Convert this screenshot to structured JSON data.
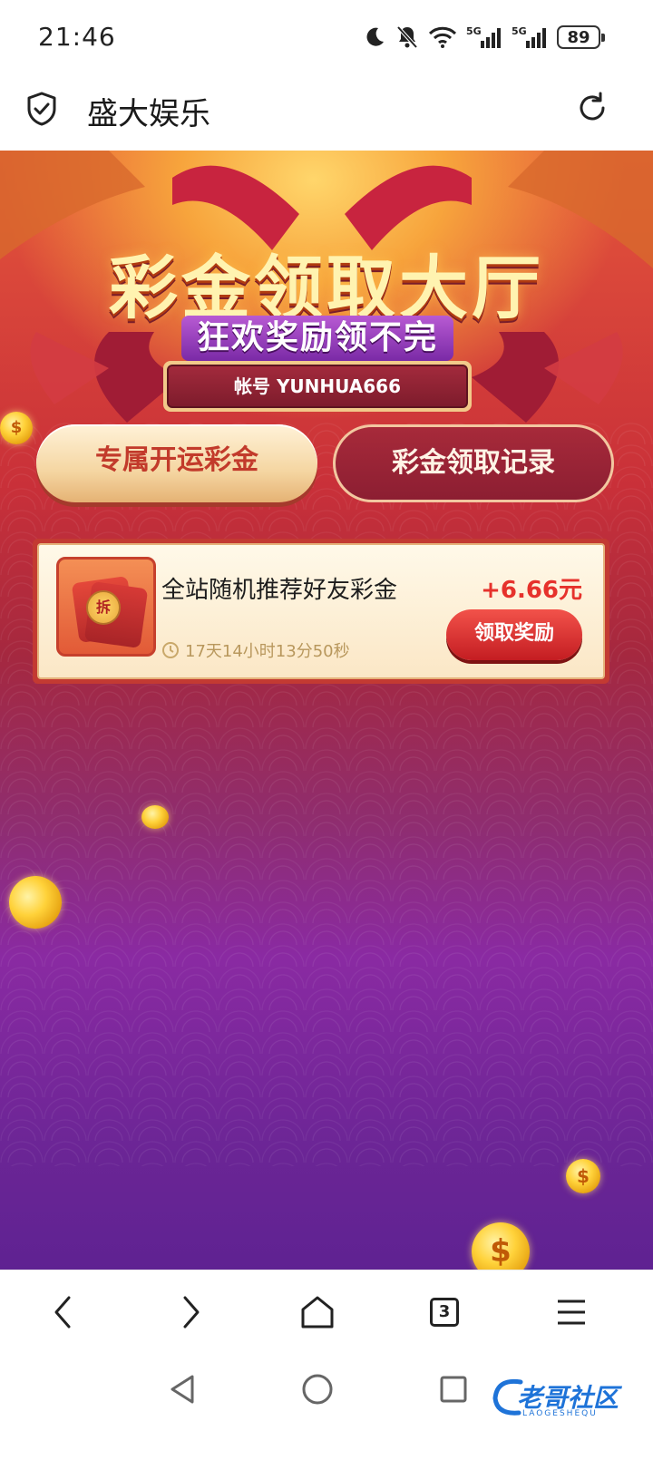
{
  "status_bar": {
    "time": "21:46",
    "battery": "89",
    "icons": [
      "moon-icon",
      "bell-muted-icon",
      "wifi-icon",
      "signal-5g-icon",
      "signal-5g-icon",
      "battery-icon"
    ],
    "network_label_1": "5G",
    "network_label_2": "5G"
  },
  "browser": {
    "site_title": "盛大娱乐",
    "tab_count": "3"
  },
  "banner": {
    "title": "彩金领取大厅",
    "subtitle": "狂欢奖励领不完",
    "account_label": "帐号 YUNHUA666"
  },
  "tabs": {
    "exclusive": "专属开运彩金",
    "records": "彩金领取记录"
  },
  "reward_card": {
    "title": "全站随机推荐好友彩金",
    "amount": "+6.66元",
    "countdown": "17天14小时13分50秒",
    "claim_label": "领取奖励",
    "seal_char": "拆"
  },
  "coin_symbol": "$",
  "watermark": {
    "text": "老哥社区",
    "sub": "LAOGESHEQU"
  },
  "colors": {
    "accent_red": "#e6322c",
    "gold": "#ffd23a",
    "purple": "#6a2595"
  }
}
